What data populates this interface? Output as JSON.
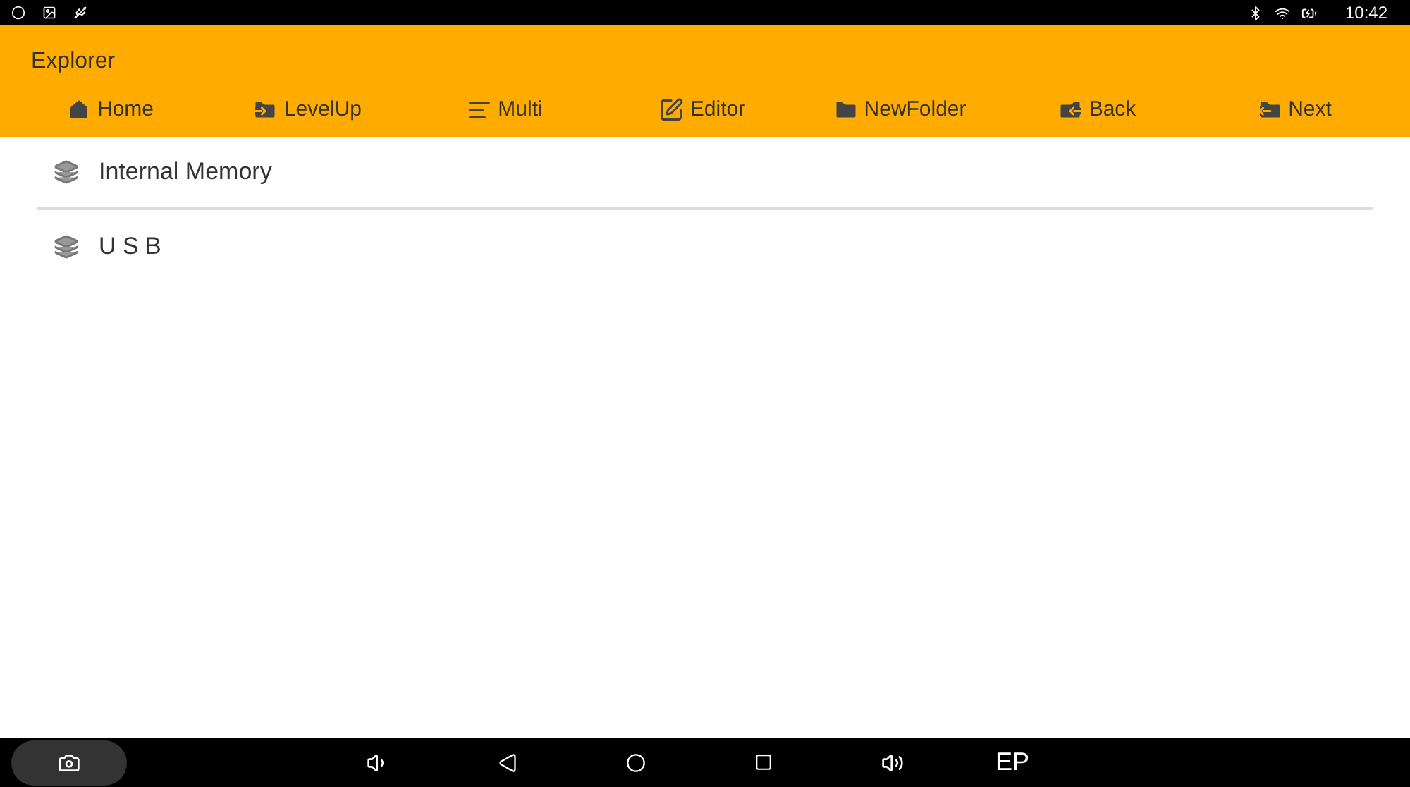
{
  "status_bar": {
    "time": "10:42"
  },
  "app_bar": {
    "title": "Explorer",
    "actions": [
      {
        "kind": "home",
        "label": "Home"
      },
      {
        "kind": "levelup",
        "label": "LevelUp"
      },
      {
        "kind": "multi",
        "label": "Multi"
      },
      {
        "kind": "editor",
        "label": "Editor"
      },
      {
        "kind": "newfolder",
        "label": "NewFolder"
      },
      {
        "kind": "back",
        "label": "Back"
      },
      {
        "kind": "next",
        "label": "Next"
      }
    ]
  },
  "storage_list": [
    {
      "label": "Internal Memory"
    },
    {
      "label": "U S B"
    }
  ],
  "nav_bar": {
    "ep_label": "EP"
  }
}
